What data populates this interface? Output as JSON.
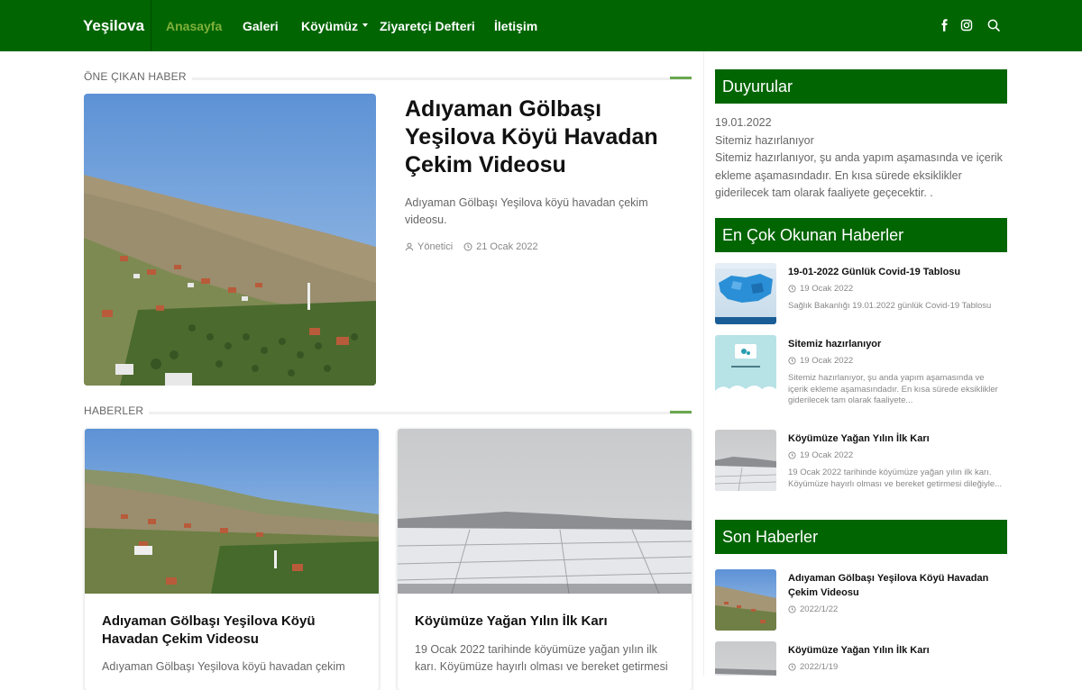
{
  "nav": {
    "brand": "Yeşilova",
    "items": [
      "Anasayfa",
      "Galeri",
      "Köyümüz",
      "Ziyaretçi Defteri",
      "İletişim"
    ],
    "active_color": "#7fb03a",
    "bg_color": "#016502",
    "icons": [
      "facebook-icon",
      "instagram-icon",
      "search-icon"
    ]
  },
  "featured": {
    "section_title": "ÖNE ÇIKAN HABER",
    "title": "Adıyaman Gölbaşı Yeşilova Köyü Havadan Çekim Videosu",
    "desc": "Adıyaman Gölbaşı Yeşilova köyü havadan çekim videosu.",
    "author": "Yönetici",
    "date": "21 Ocak 2022"
  },
  "news": {
    "section_title": "HABERLER",
    "cards": [
      {
        "title": "Adıyaman Gölbaşı Yeşilova Köyü Havadan Çekim Videosu",
        "desc": "Adıyaman Gölbaşı Yeşilova köyü havadan çekim"
      },
      {
        "title": "Köyümüze Yağan Yılın İlk Karı",
        "desc": "19 Ocak 2022 tarihinde köyümüze yağan yılın ilk karı. Köyümüze hayırlı olması ve bereket getirmesi"
      }
    ]
  },
  "sidebar": {
    "announcements": {
      "title": "Duyurular",
      "date": "19.01.2022",
      "headline": "Sitemiz hazırlanıyor",
      "body": "Sitemiz hazırlanıyor, şu anda yapım aşamasında ve içerik ekleme aşamasındadır. En kısa sürede eksiklikler giderilecek tam olarak faaliyete geçecektir. ."
    },
    "most_read": {
      "title": "En Çok Okunan Haberler",
      "items": [
        {
          "title": "19-01-2022 Günlük Covid-19 Tablosu",
          "date": "19 Ocak 2022",
          "desc": "Sağlık Bakanlığı 19.01.2022 günlük Covid-19 Tablosu"
        },
        {
          "title": "Sitemiz hazırlanıyor",
          "date": "19 Ocak 2022",
          "desc": "Sitemiz hazırlanıyor, şu anda yapım aşamasında ve içerik ekleme aşamasındadır. En kısa sürede eksiklikler giderilecek tam olarak faaliyete..."
        },
        {
          "title": "Köyümüze Yağan Yılın İlk Karı",
          "date": "19 Ocak 2022",
          "desc": "19 Ocak 2022 tarihinde köyümüze yağan yılın ilk karı. Köyümüze hayırlı olması ve bereket getirmesi dileğiyle..."
        }
      ]
    },
    "latest": {
      "title": "Son Haberler",
      "items": [
        {
          "title": "Adıyaman Gölbaşı Yeşilova Köyü Havadan Çekim Videosu",
          "date": "2022/1/22"
        },
        {
          "title": "Köyümüze Yağan Yılın İlk Karı",
          "date": "2022/1/19"
        }
      ]
    }
  }
}
